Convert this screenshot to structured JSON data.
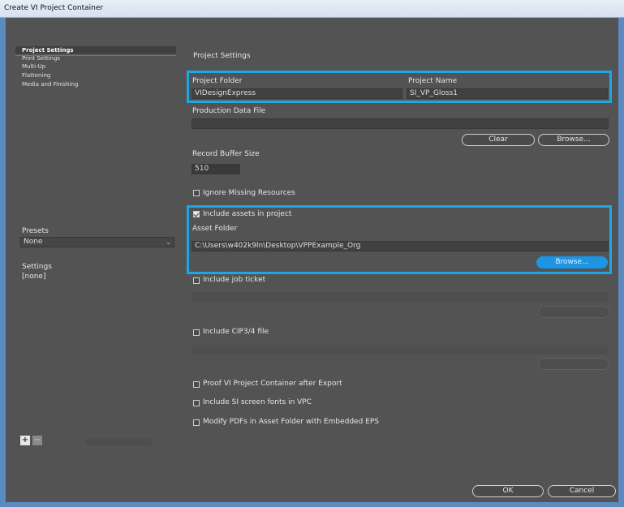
{
  "window": {
    "title": "Create VI Project Container"
  },
  "nav": {
    "items": [
      {
        "label": "Project Settings",
        "selected": true
      },
      {
        "label": "Print Settings",
        "selected": false
      },
      {
        "label": "Multi-Up",
        "selected": false
      },
      {
        "label": "Flattening",
        "selected": false
      },
      {
        "label": "Media and Finishing",
        "selected": false
      }
    ]
  },
  "presets": {
    "label": "Presets",
    "value": "None",
    "arrow": "chevron-down-icon"
  },
  "settings": {
    "label": "Settings",
    "value": "[none]"
  },
  "bottom_left": {
    "add": "+",
    "remove": "−"
  },
  "main": {
    "section_title": "Project Settings",
    "project_folder": {
      "label": "Project Folder",
      "value": "VIDesignExpress"
    },
    "project_name": {
      "label": "Project Name",
      "value": "SI_VP_Gloss1"
    },
    "production_data_file": {
      "label": "Production Data File",
      "value": ""
    },
    "clear_label": "Clear",
    "browse_label": "Browse...",
    "record_buffer": {
      "label": "Record Buffer Size",
      "value": "510"
    },
    "ignore_missing": "Ignore Missing Resources",
    "include_assets": "Include assets in project",
    "asset_folder": {
      "label": "Asset Folder",
      "value": "C:\\Users\\w402k9ln\\Desktop\\VPPExample_Org"
    },
    "asset_browse_label": "Browse...",
    "include_job_ticket": "Include job ticket",
    "include_cip3": "Include CIP3/4 file",
    "proof_vi": "Proof VI Project Container after Export",
    "include_si_fonts": "Include SI screen fonts in VPC",
    "modify_pdfs": "Modify PDFs in Asset Folder with Embedded EPS"
  },
  "footer": {
    "ok_label": "OK",
    "cancel_label": "Cancel"
  },
  "colors": {
    "highlight": "#1ca8e6",
    "dialog_bg": "#535353",
    "browse_blue": "#1c96e4"
  }
}
